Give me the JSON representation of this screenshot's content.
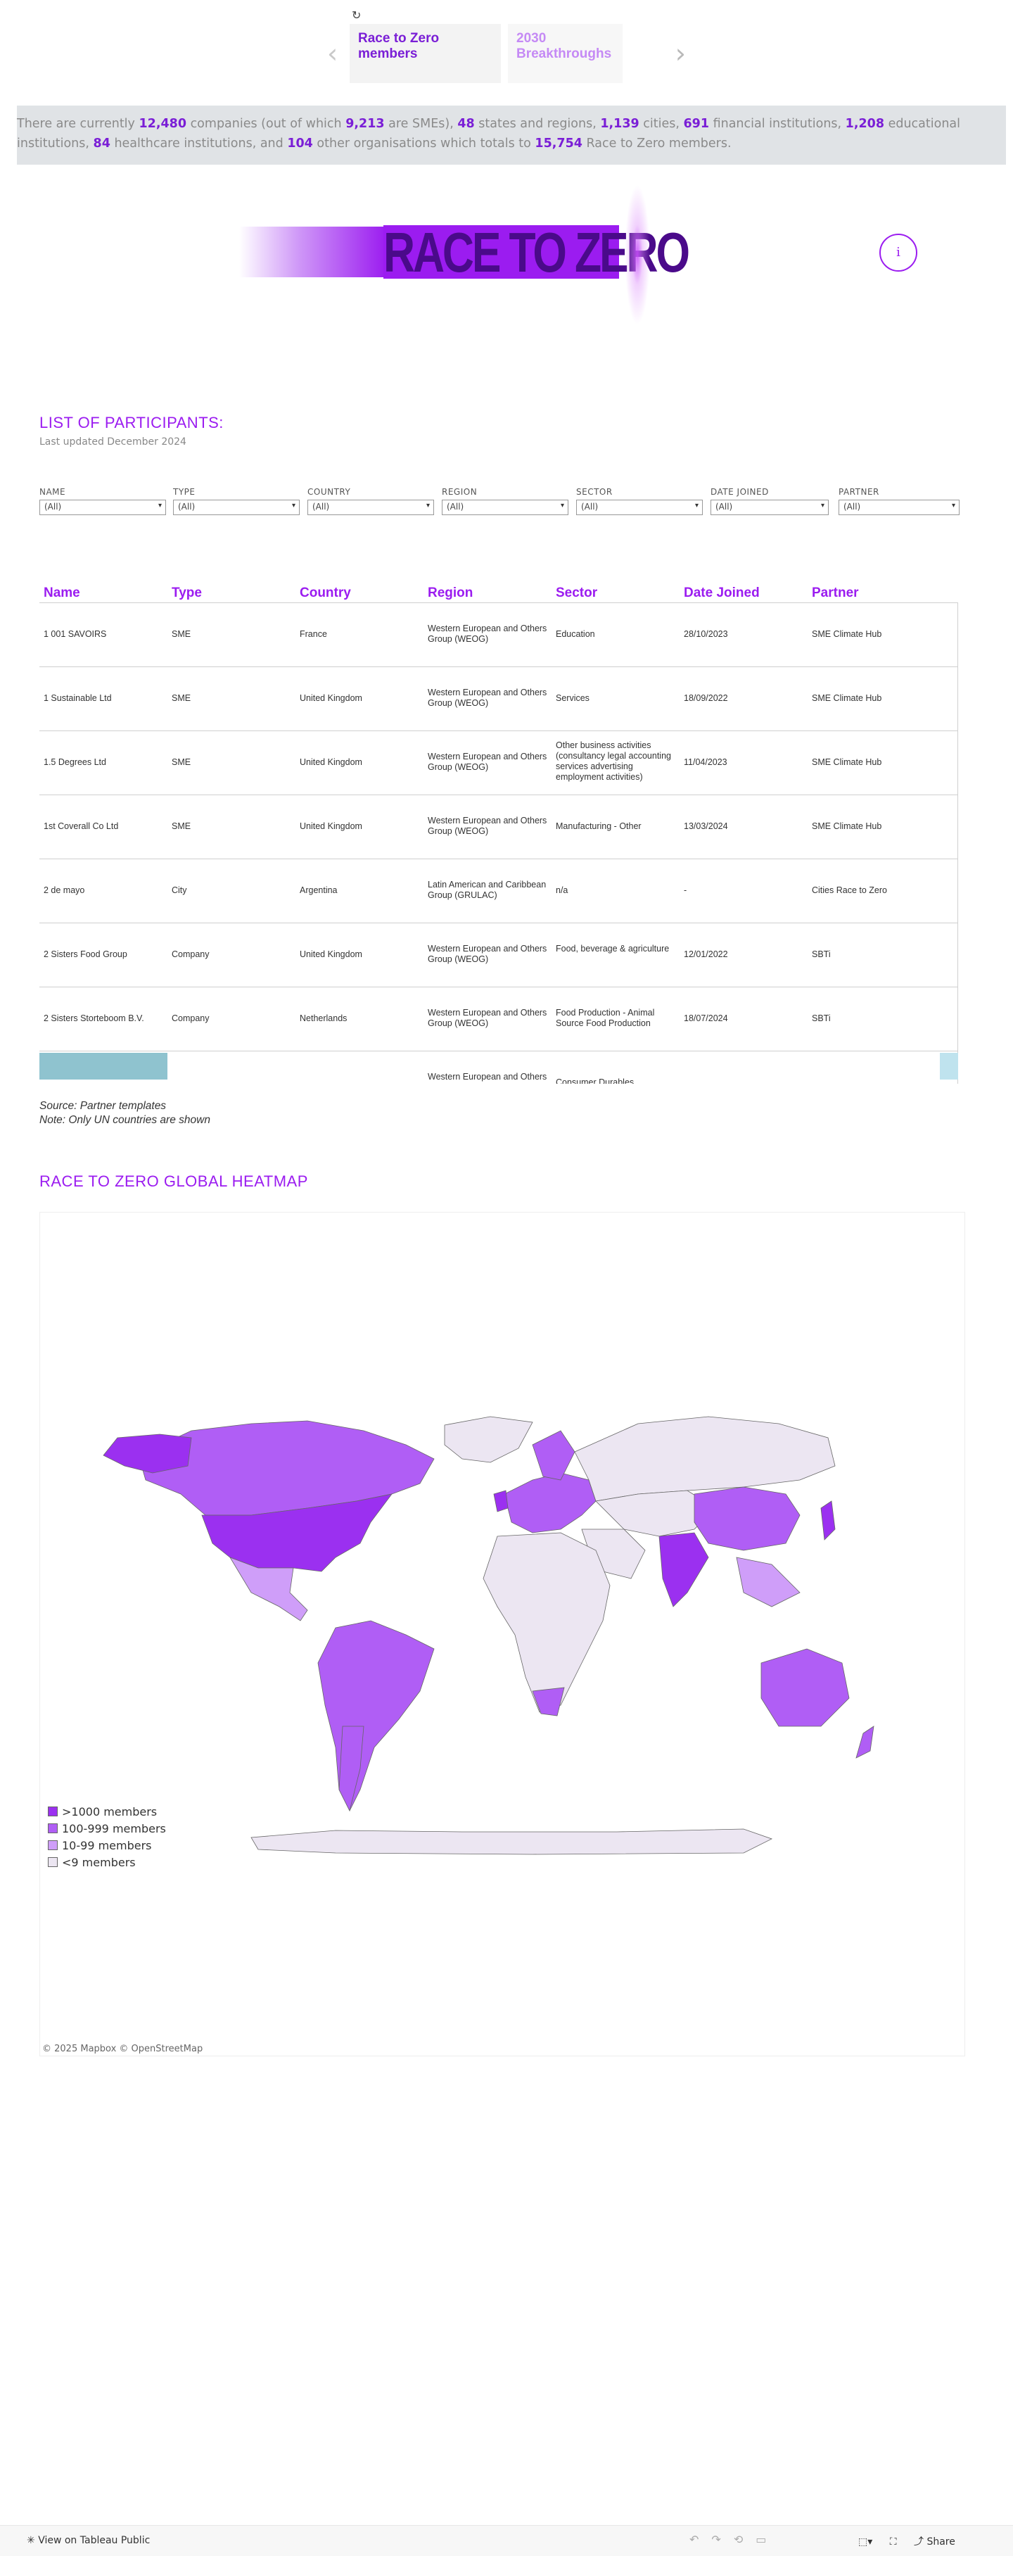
{
  "nav": {
    "tabs": [
      {
        "label": "Race to Zero members"
      },
      {
        "label": "2030 Breakthroughs"
      }
    ]
  },
  "summary": {
    "p1": "There are currently ",
    "companies": "12,480",
    "p2": " companies (out of which ",
    "smes": "9,213",
    "p3": " are SMEs), ",
    "states": "48",
    "p4": " states and regions, ",
    "cities": "1,139",
    "p5": " cities, ",
    "financial": "691",
    "p6": " financial institutions, ",
    "educational": "1,208",
    "p7": " educational institutions, ",
    "healthcare": "84",
    "p8": " healthcare institutions, and ",
    "other": "104",
    "p9": " other organisations which totals to ",
    "total": "15,754",
    "p10": " Race to Zero members."
  },
  "logo": {
    "text": "RACE TO ZERO"
  },
  "info_button": {
    "label": "i"
  },
  "participants": {
    "title": "LIST OF PARTICIPANTS:",
    "updated": "Last updated December 2024",
    "filters": [
      {
        "label": "NAME",
        "value": "(All)"
      },
      {
        "label": "TYPE",
        "value": "(All)"
      },
      {
        "label": "COUNTRY",
        "value": "(All)"
      },
      {
        "label": "REGION",
        "value": "(All)"
      },
      {
        "label": "SECTOR",
        "value": "(All)"
      },
      {
        "label": "DATE JOINED",
        "value": "(All)"
      },
      {
        "label": "PARTNER",
        "value": "(All)"
      }
    ],
    "columns": [
      "Name",
      "Type",
      "Country",
      "Region",
      "Sector",
      "Date Joined",
      "Partner"
    ],
    "rows": [
      [
        "1 001 SAVOIRS",
        "SME",
        "France",
        "Western European and Others Group (WEOG)",
        "Education",
        "28/10/2023",
        "SME Climate Hub"
      ],
      [
        "1 Sustainable Ltd",
        "SME",
        "United Kingdom",
        "Western European and Others Group (WEOG)",
        "Services",
        "18/09/2022",
        "SME Climate Hub"
      ],
      [
        "1.5 Degrees Ltd",
        "SME",
        "United Kingdom",
        "Western European and Others Group (WEOG)",
        "Other business activities (consultancy legal accounting services advertising employment activities)",
        "11/04/2023",
        "SME Climate Hub"
      ],
      [
        "1st Coverall Co Ltd",
        "SME",
        "United Kingdom",
        "Western European and Others Group (WEOG)",
        "Manufacturing - Other",
        "13/03/2024",
        "SME Climate Hub"
      ],
      [
        "2 de mayo",
        "City",
        "Argentina",
        "Latin American and Caribbean Group (GRULAC)",
        "n/a",
        "-",
        "Cities Race to Zero"
      ],
      [
        "2 Sisters Food Group",
        "Company",
        "United Kingdom",
        "Western European and Others Group (WEOG)",
        "Food, beverage & agriculture",
        "12/01/2022",
        "SBTi"
      ],
      [
        "2 Sisters Storteboom B.V.",
        "Company",
        "Netherlands",
        "Western European and Others Group (WEOG)",
        "Food Production - Animal Source Food Production",
        "18/07/2024",
        "SBTi"
      ],
      [
        "",
        "",
        "",
        "Western European and Others",
        "Consumer Durables,",
        "",
        ""
      ]
    ],
    "source": "Source: Partner templates",
    "note": "Note: Only UN countries are shown"
  },
  "heatmap": {
    "title": "RACE TO ZERO GLOBAL HEATMAP",
    "legend": [
      {
        "label": ">1000 members",
        "color": "#9b30f0"
      },
      {
        "label": "100-999 members",
        "color": "#b05ef5"
      },
      {
        "label": "10-99 members",
        "color": "#cf9ef9"
      },
      {
        "label": "<9 members",
        "color": "#ece6f2"
      }
    ],
    "credit": "© 2025 Mapbox © OpenStreetMap"
  },
  "toolbar": {
    "view_label": "View on Tableau Public",
    "share_label": "Share"
  }
}
